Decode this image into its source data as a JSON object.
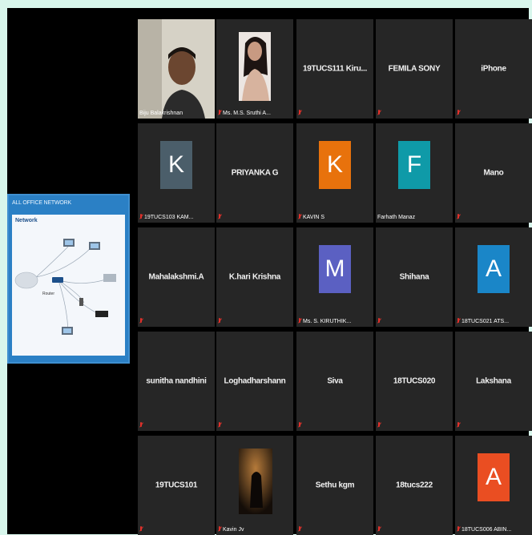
{
  "shared_screen": {
    "title": "ALL OFFICE NETWORK",
    "heading": "Network",
    "router_label": "Router"
  },
  "participants": [
    {
      "label": "Biju Balakrishnan",
      "center": "",
      "avatar": "",
      "type": "video-man",
      "muted": false,
      "active": true
    },
    {
      "label": "Ms. M.S. Sruthi A...",
      "center": "",
      "avatar": "",
      "type": "photo-woman",
      "muted": true
    },
    {
      "label": "",
      "center": "19TUCS111 Kiru...",
      "avatar": "",
      "muted": true
    },
    {
      "label": "",
      "center": "FEMILA SONY",
      "avatar": "",
      "muted": true
    },
    {
      "label": "",
      "center": "iPhone",
      "avatar": "",
      "muted": true
    },
    {
      "label": "19TUCS103 KAM...",
      "center": "",
      "avatar": "K",
      "avatar_color": "#4b5e6a",
      "muted": true
    },
    {
      "label": "",
      "center": "PRIYANKA G",
      "avatar": "",
      "muted": true
    },
    {
      "label": "KAVIN S",
      "center": "",
      "avatar": "K",
      "avatar_color": "#e8720c",
      "muted": true
    },
    {
      "label": "Farhath Manaz",
      "center": "",
      "avatar": "F",
      "avatar_color": "#0f9aa8",
      "muted": false
    },
    {
      "label": "",
      "center": "Mano",
      "avatar": "",
      "muted": true
    },
    {
      "label": "",
      "center": "Mahalakshmi.A",
      "avatar": "",
      "muted": true
    },
    {
      "label": "",
      "center": "K.hari Krishna",
      "avatar": "",
      "muted": true
    },
    {
      "label": "Ms. S. KIRUTHIK...",
      "center": "",
      "avatar": "M",
      "avatar_color": "#5b60c2",
      "muted": true
    },
    {
      "label": "",
      "center": "Shihana",
      "avatar": "",
      "muted": true
    },
    {
      "label": "18TUCS021 ATS...",
      "center": "",
      "avatar": "A",
      "avatar_color": "#1a86c8",
      "muted": true
    },
    {
      "label": "",
      "center": "sunitha nandhini",
      "avatar": "",
      "muted": true
    },
    {
      "label": "",
      "center": "Loghadharshann",
      "avatar": "",
      "muted": true
    },
    {
      "label": "",
      "center": "Siva",
      "avatar": "",
      "muted": true
    },
    {
      "label": "",
      "center": "18TUCS020",
      "avatar": "",
      "muted": true
    },
    {
      "label": "",
      "center": "Lakshana",
      "avatar": "",
      "muted": true
    },
    {
      "label": "",
      "center": "19TUCS101",
      "avatar": "",
      "muted": true
    },
    {
      "label": "Kavin Jv",
      "center": "",
      "avatar": "",
      "type": "photo-dark",
      "muted": true
    },
    {
      "label": "",
      "center": "Sethu kgm",
      "avatar": "",
      "muted": true
    },
    {
      "label": "",
      "center": "18tucs222",
      "avatar": "",
      "muted": true
    },
    {
      "label": "18TUCS006 ABIN...",
      "center": "",
      "avatar": "A",
      "avatar_color": "#ea4e22",
      "muted": true
    }
  ]
}
